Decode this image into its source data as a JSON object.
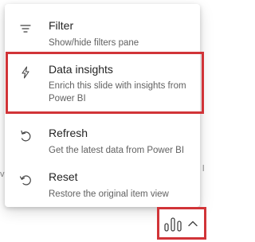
{
  "background": {
    "left_fragment": "va",
    "right_fragment": "l"
  },
  "menu": {
    "items": [
      {
        "title": "Filter",
        "description": "Show/hide filters pane",
        "icon": "filter-lines-icon"
      },
      {
        "title": "Data insights",
        "description": "Enrich this slide with insights from Power BI",
        "icon": "lightning-bolt-icon",
        "highlighted": true
      },
      {
        "title": "Refresh",
        "description": "Get the latest data from Power BI",
        "icon": "refresh-arrow-icon"
      },
      {
        "title": "Reset",
        "description": "Restore the original item view",
        "icon": "reset-arrow-icon"
      }
    ]
  },
  "toolbar": {
    "button_icons": [
      "bar-chart-icon",
      "chevron-up-icon"
    ]
  },
  "colors": {
    "highlight_border": "#d13438",
    "text_primary": "#242424",
    "text_secondary": "#616161"
  }
}
